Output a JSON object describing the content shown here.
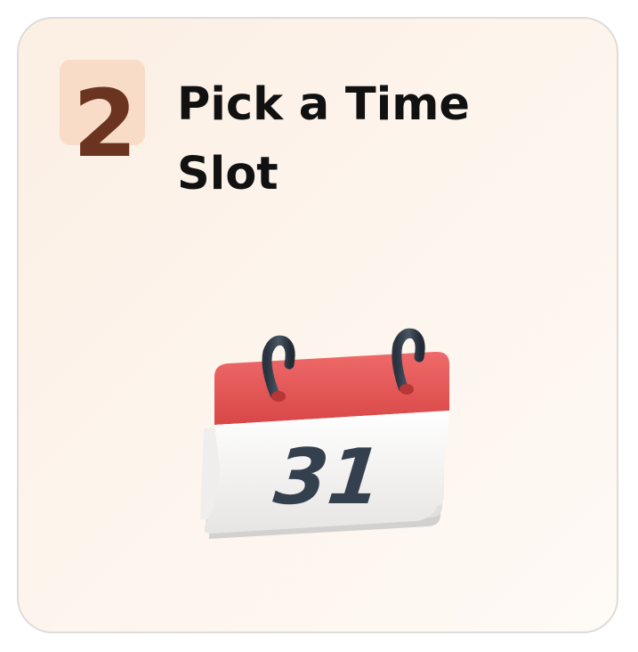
{
  "step": {
    "number": "2",
    "title": "Pick a Time Slot"
  },
  "illustration": {
    "icon": "calendar-icon",
    "date_number": "31"
  },
  "colors": {
    "badge_bg": "#f8dcc8",
    "number_color": "#6b3420",
    "calendar_header": "#e85555",
    "calendar_digits": "#34404e"
  }
}
